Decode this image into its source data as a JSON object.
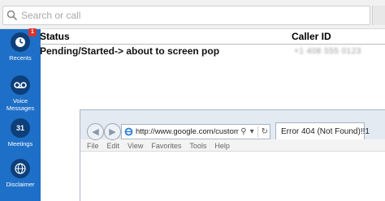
{
  "search": {
    "placeholder": "Search or call"
  },
  "sidebar": {
    "items": [
      {
        "label": "Recents",
        "icon": "clock-icon",
        "badge": "1"
      },
      {
        "label": "Voice Messages",
        "icon": "voicemail-icon"
      },
      {
        "label": "Meetings",
        "icon": "calendar-icon",
        "calendar_day": "31"
      },
      {
        "label": "Disclaimer",
        "icon": "globe-icon"
      }
    ]
  },
  "table": {
    "headers": {
      "status": "Status",
      "caller_id": "Caller ID"
    },
    "rows": [
      {
        "status": "Pending/Started-> about to screen pop",
        "caller_id": "+1 408 555 0123"
      }
    ]
  },
  "browser": {
    "address": "http://www.google.com/customerSearch",
    "tab_title": "Error 404 (Not Found)!!1",
    "menu": [
      "File",
      "Edit",
      "View",
      "Favorites",
      "Tools",
      "Help"
    ]
  },
  "colors": {
    "sidebar": "#1e6fc7",
    "sidebar_icon_bg": "#0d3f7a",
    "badge": "#d9332b"
  }
}
